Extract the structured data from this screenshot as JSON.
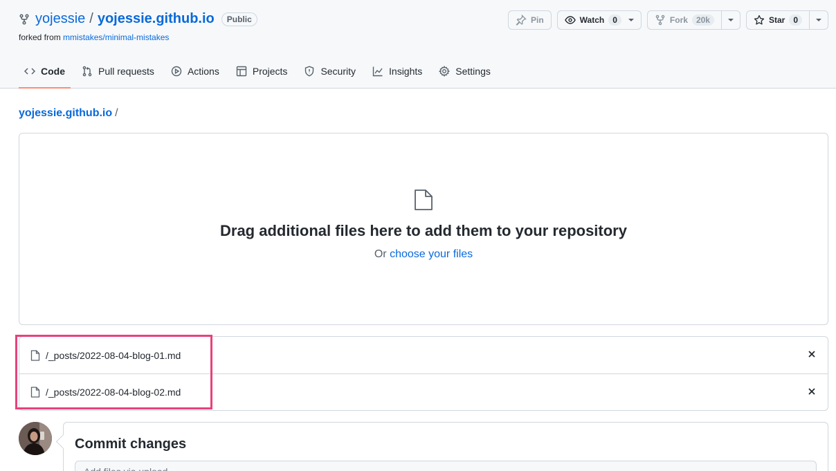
{
  "repo": {
    "owner": "yojessie",
    "separator": "/",
    "name": "yojessie.github.io",
    "visibility": "Public",
    "forked_prefix": "forked from ",
    "forked_from": "mmistakes/minimal-mistakes"
  },
  "actions": {
    "pin_label": "Pin",
    "watch_label": "Watch",
    "watch_count": "0",
    "fork_label": "Fork",
    "fork_count": "20k",
    "star_label": "Star",
    "star_count": "0"
  },
  "tabs": [
    {
      "label": "Code",
      "icon": "code-icon",
      "active": true
    },
    {
      "label": "Pull requests",
      "icon": "pull-request-icon"
    },
    {
      "label": "Actions",
      "icon": "play-icon"
    },
    {
      "label": "Projects",
      "icon": "table-icon"
    },
    {
      "label": "Security",
      "icon": "shield-icon"
    },
    {
      "label": "Insights",
      "icon": "graph-icon"
    },
    {
      "label": "Settings",
      "icon": "gear-icon"
    }
  ],
  "breadcrumb": {
    "repo_link": "yojessie.github.io",
    "separator": "/"
  },
  "dropzone": {
    "title": "Drag additional files here to add them to your repository",
    "sub_prefix": "Or ",
    "sub_link": "choose your files"
  },
  "files": [
    {
      "name": "/_posts/2022-08-04-blog-01.md"
    },
    {
      "name": "/_posts/2022-08-04-blog-02.md"
    }
  ],
  "commit": {
    "title": "Commit changes",
    "placeholder": "Add files via upload"
  },
  "colors": {
    "link": "#0969da",
    "active_tab_underline": "#fd8c73",
    "highlight_border": "#e8417a",
    "border": "#d0d7de"
  }
}
